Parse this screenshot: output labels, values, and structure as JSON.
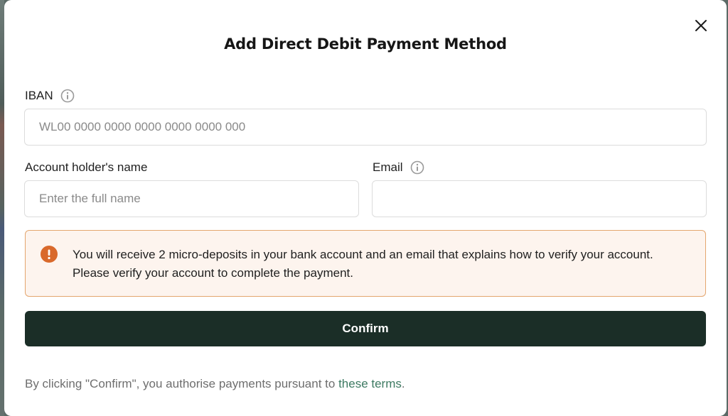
{
  "modal": {
    "title": "Add Direct Debit Payment Method",
    "close_icon": "close-icon"
  },
  "iban": {
    "label": "IBAN",
    "info_icon": "info-icon",
    "placeholder": "WL00 0000 0000 0000 0000 0000 000",
    "value": ""
  },
  "account_holder": {
    "label": "Account holder's name",
    "placeholder": "Enter the full name",
    "value": ""
  },
  "email": {
    "label": "Email",
    "info_icon": "info-icon",
    "placeholder": "",
    "value": ""
  },
  "notice": {
    "icon": "alert-icon",
    "text": "You will receive 2 micro-deposits in your bank account and an email that explains how to verify your account. Please verify your account to complete the payment."
  },
  "confirm": {
    "label": "Confirm"
  },
  "footer": {
    "text": "By clicking \"Confirm\", you authorise payments pursuant to",
    "link_text": "these terms",
    "end": "."
  },
  "colors": {
    "primary_button": "#1b2e27",
    "link": "#3d7a62",
    "notice_border": "#e4a66e",
    "notice_background": "#fdf4ee",
    "alert_icon": "#d9692b"
  }
}
